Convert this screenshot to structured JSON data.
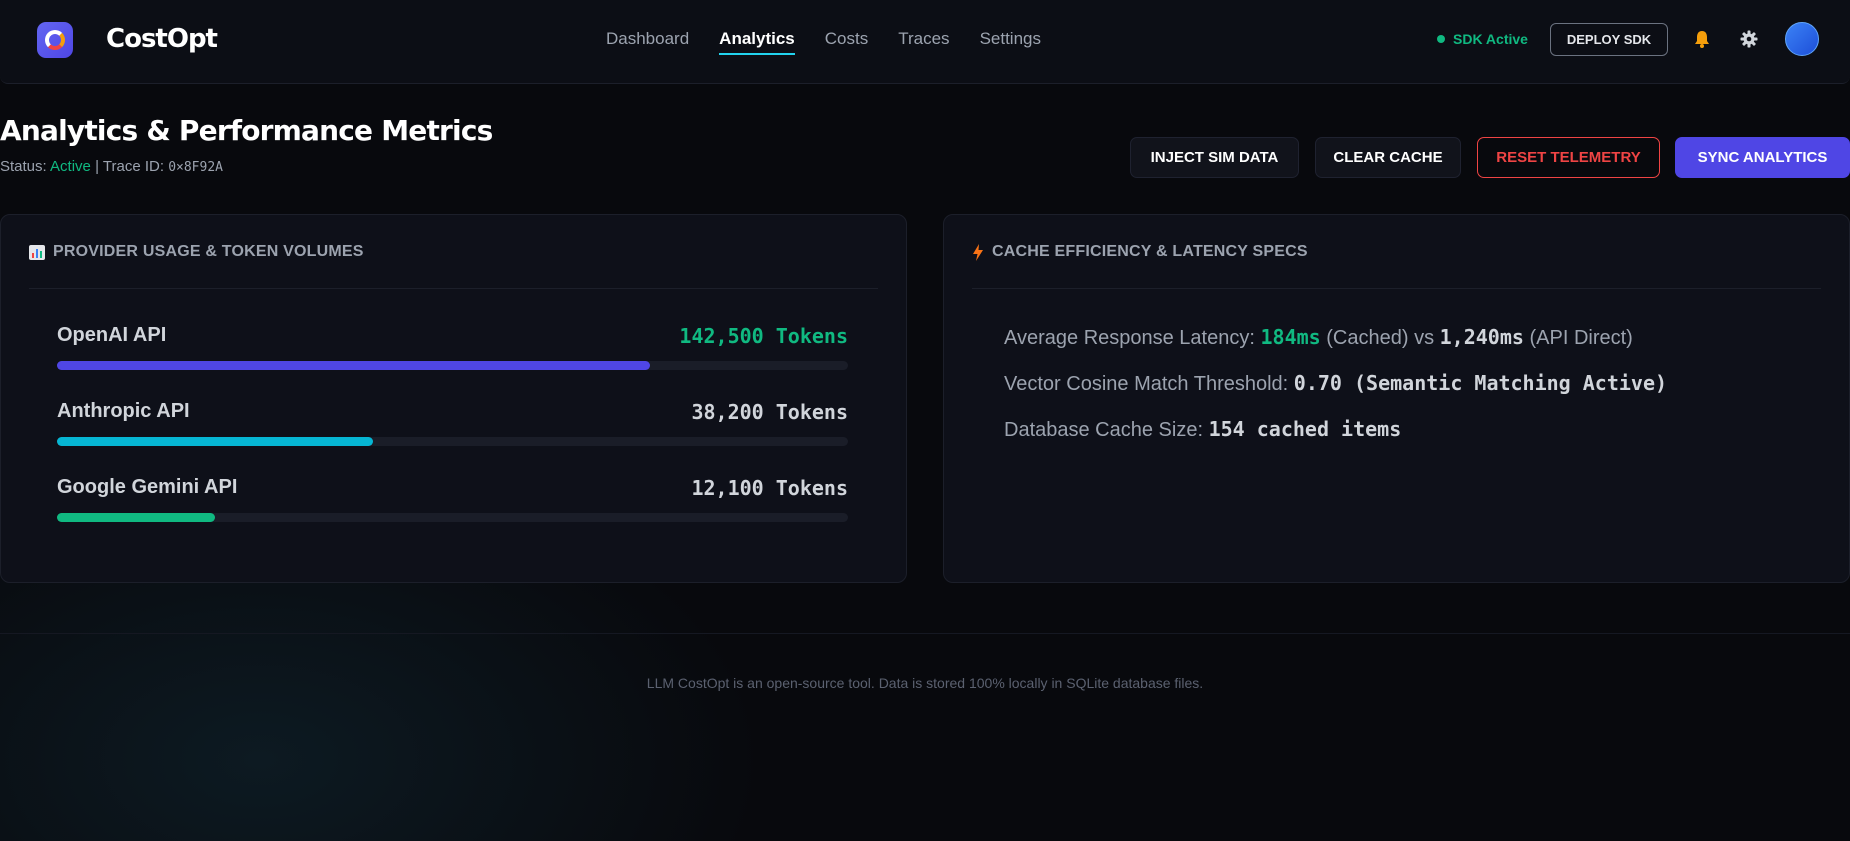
{
  "app": {
    "brand": "CostOpt",
    "nav": [
      {
        "label": "Dashboard",
        "active": false
      },
      {
        "label": "Analytics",
        "active": true
      },
      {
        "label": "Costs",
        "active": false
      },
      {
        "label": "Traces",
        "active": false
      },
      {
        "label": "Settings",
        "active": false
      }
    ],
    "sdk_status": "SDK Active",
    "deploy_label": "DEPLOY SDK",
    "icons": [
      "logo-icon",
      "bell-icon",
      "gear-icon",
      "avatar"
    ]
  },
  "page": {
    "title": "Analytics & Performance Metrics",
    "status_label": "Status:",
    "status_value": "Active",
    "separator": "|",
    "trace_label": "Trace ID:",
    "trace_id": "0×8F92A",
    "actions": {
      "inject": "INJECT SIM DATA",
      "clear": "CLEAR CACHE",
      "reset": "RESET TELEMETRY",
      "sync": "SYNC ANALYTICS"
    }
  },
  "usage": {
    "title": "PROVIDER USAGE & TOKEN VOLUMES",
    "providers": [
      {
        "name": "OpenAI API",
        "tokens": "142,500 Tokens",
        "fill_fraction": 0.75,
        "color": "#4f46e5"
      },
      {
        "name": "Anthropic API",
        "tokens": "38,200 Tokens",
        "fill_fraction": 0.4,
        "color": "#06b6d4"
      },
      {
        "name": "Google Gemini API",
        "tokens": "12,100 Tokens",
        "fill_fraction": 0.2,
        "color": "#10b981"
      }
    ]
  },
  "cache": {
    "title": "CACHE EFFICIENCY & LATENCY SPECS",
    "latency": {
      "label": "Average Response Latency:",
      "cached_value": "184ms",
      "cached_label": "(Cached) vs",
      "direct_value": "1,240ms",
      "direct_label": "(API Direct)"
    },
    "threshold": {
      "label": "Vector Cosine Match Threshold:",
      "value": "0.70 (Semantic Matching Active)"
    },
    "size": {
      "label": "Database Cache Size:",
      "value": "154 cached items"
    }
  },
  "footer": {
    "text": "LLM CostOpt is an open-source tool. Data is stored 100% locally in SQLite database files."
  },
  "colors": {
    "accent": "#4f46e5",
    "success": "#10b981",
    "danger": "#ef4444",
    "nav_underline": "#22d3ee",
    "background": "#08090d"
  }
}
